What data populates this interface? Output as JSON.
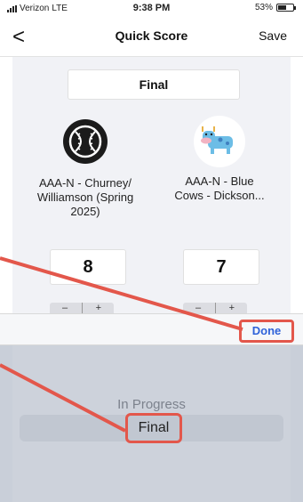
{
  "status_bar": {
    "carrier": "Verizon",
    "network": "LTE",
    "time": "9:38 PM",
    "battery": "53%"
  },
  "nav": {
    "back_icon": "chevron-left-icon",
    "back_glyph": "<",
    "title": "Quick Score",
    "save_label": "Save"
  },
  "game": {
    "status_value": "Final",
    "home": {
      "name": "AAA-N - Churney/ Williamson (Spring 2025)",
      "logo_icon": "baseball-icon",
      "score": "8"
    },
    "away": {
      "name": "AAA-N - Blue Cows - Dickson...",
      "logo_icon": "cow-icon",
      "score": "7"
    }
  },
  "stepper": {
    "minus": "–",
    "plus": "+"
  },
  "picker": {
    "done_label": "Done",
    "options": [
      "In Progress",
      "Final"
    ],
    "selected": "Final"
  },
  "colors": {
    "highlight": "#e3574b",
    "link_blue": "#2f62d9"
  }
}
